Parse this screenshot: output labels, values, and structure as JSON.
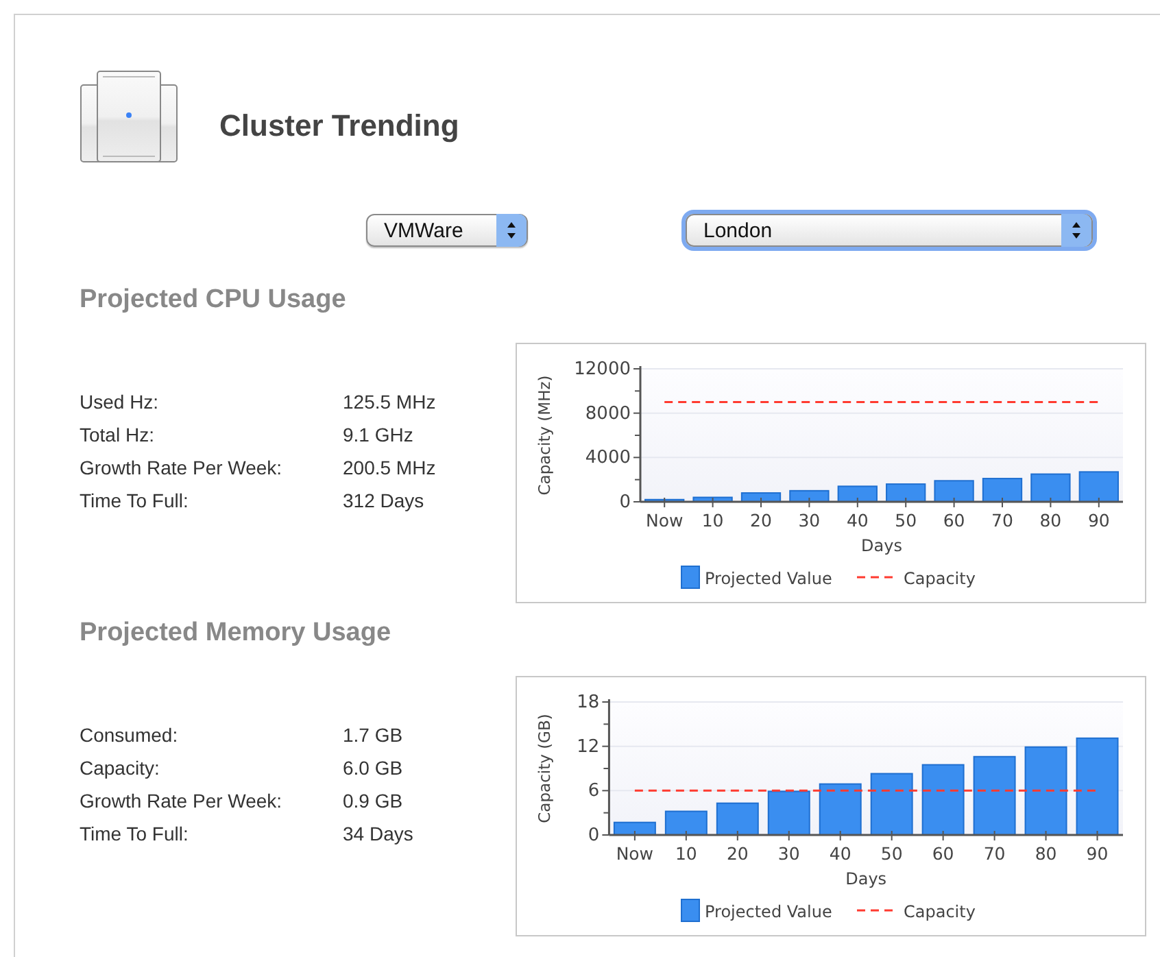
{
  "header": {
    "title": "Cluster Trending"
  },
  "selects": [
    {
      "value": "VMWare",
      "focused": false
    },
    {
      "value": "London",
      "focused": true
    }
  ],
  "sections": [
    {
      "title": "Projected CPU Usage",
      "stats": [
        {
          "label": "Used Hz:",
          "value": "125.5 MHz"
        },
        {
          "label": "Total Hz:",
          "value": "9.1 GHz"
        },
        {
          "label": "Growth Rate Per Week:",
          "value": "200.5 MHz"
        },
        {
          "label": "Time To Full:",
          "value": "312 Days"
        }
      ],
      "chart_data": {
        "type": "bar",
        "xlabel": "Days",
        "ylabel": "Capacity (MHz)",
        "categories": [
          "Now",
          "10",
          "20",
          "30",
          "40",
          "50",
          "60",
          "70",
          "80",
          "90"
        ],
        "series": [
          {
            "name": "Projected Value",
            "color": "#3a8ef0",
            "values": [
              200,
              400,
              800,
              1000,
              1400,
              1600,
              1900,
              2100,
              2500,
              2700
            ]
          },
          {
            "name": "Capacity",
            "type": "line",
            "line_style": "dashed",
            "color": "#ff3b30",
            "values": [
              9000,
              9000,
              9000,
              9000,
              9000,
              9000,
              9000,
              9000,
              9000,
              9000
            ]
          }
        ],
        "legend": "bottom",
        "ylim": [
          0,
          12000
        ],
        "yticks": [
          0,
          4000,
          8000,
          12000
        ]
      }
    },
    {
      "title": "Projected Memory Usage",
      "stats": [
        {
          "label": "Consumed:",
          "value": "1.7 GB"
        },
        {
          "label": "Capacity:",
          "value": "6.0 GB"
        },
        {
          "label": "Growth Rate Per Week:",
          "value": "0.9 GB"
        },
        {
          "label": "Time To Full:",
          "value": "34 Days"
        }
      ],
      "chart_data": {
        "type": "bar",
        "xlabel": "Days",
        "ylabel": "Capacity (GB)",
        "categories": [
          "Now",
          "10",
          "20",
          "30",
          "40",
          "50",
          "60",
          "70",
          "80",
          "90"
        ],
        "series": [
          {
            "name": "Projected Value",
            "color": "#3a8ef0",
            "values": [
              1.7,
              3.2,
              4.3,
              5.9,
              6.9,
              8.3,
              9.5,
              10.6,
              11.9,
              13.1
            ]
          },
          {
            "name": "Capacity",
            "type": "line",
            "line_style": "dashed",
            "color": "#ff3b30",
            "values": [
              6,
              6,
              6,
              6,
              6,
              6,
              6,
              6,
              6,
              6
            ]
          }
        ],
        "legend": "bottom",
        "ylim": [
          0,
          18
        ],
        "yticks": [
          0,
          6,
          12,
          18
        ]
      }
    }
  ]
}
